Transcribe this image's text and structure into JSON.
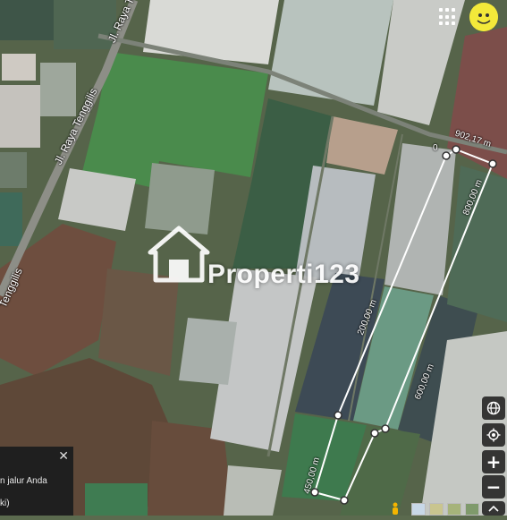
{
  "map": {
    "roads": [
      {
        "label": "Jl. Raya Tenggilis"
      },
      {
        "label": "Jl. Raya Tenggilis"
      },
      {
        "label": "Tenggilis"
      }
    ],
    "measurement": {
      "segments": [
        {
          "label": "902,17 m"
        },
        {
          "label": "800,00 m"
        },
        {
          "label": "200,00 m"
        },
        {
          "label": "600,00 m"
        },
        {
          "label": "450,00 m"
        },
        {
          "label": "0"
        }
      ],
      "line_color": "#ffffff"
    },
    "watermark": {
      "text": "Properti123"
    },
    "imagery_credit": "©2023 Google"
  },
  "controls": {
    "globe_icon": "globe-icon",
    "locate_icon": "my-location-icon",
    "zoom_in": "+",
    "zoom_out": "−",
    "apps_icon": "apps-grid-icon",
    "avatar_icon": "user-avatar-icon",
    "pegman_icon": "pegman-icon",
    "expand_icon": "chevron-up-icon"
  },
  "infobox": {
    "lines": [
      "n jalur Anda",
      "ki)"
    ],
    "close": "✕"
  },
  "colors": {
    "field_green": "#4a8b4c",
    "pond_light": "#b9c0bd",
    "pond_dark": "#3d4a55",
    "soil_brown": "#6b4a3a",
    "avatar_yellow": "#f3e93a"
  }
}
